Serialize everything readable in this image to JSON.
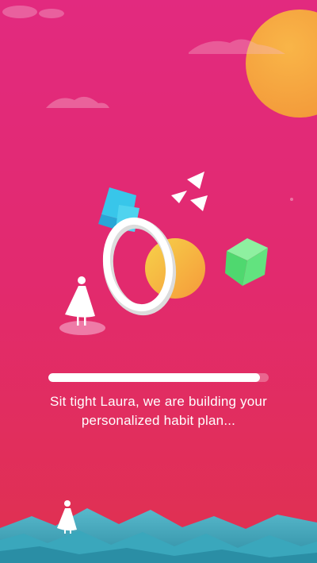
{
  "loading": {
    "progress": 0.96,
    "message_line1": "Sit tight Laura, we are building your",
    "message_line2": "personalized habit plan..."
  },
  "colors": {
    "background_top": "#e22a7f",
    "background_bottom": "#e0314f",
    "sun": "#f6a63e",
    "progress_fill": "#ffffff"
  },
  "icons": [
    "sun-icon",
    "cloud-icon",
    "crystal-icon",
    "triangles-icon",
    "portal-ring-icon",
    "cube-icon",
    "figure-icon",
    "mountains-icon"
  ]
}
